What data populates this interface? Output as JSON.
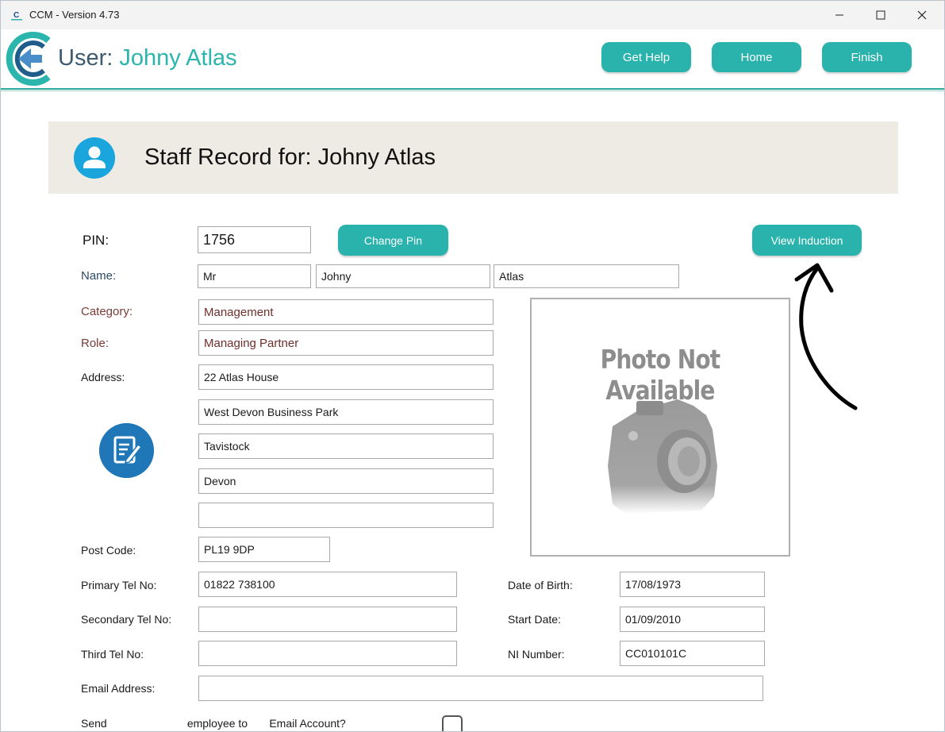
{
  "window": {
    "title": "CCM - Version 4.73",
    "controls": [
      "minimize-icon",
      "maximize-icon",
      "close-icon"
    ]
  },
  "header": {
    "user_prefix": "User: ",
    "user_name": "Johny Atlas",
    "buttons": {
      "help": "Get Help",
      "home": "Home",
      "finish": "Finish"
    }
  },
  "banner": {
    "icon": "user-icon",
    "title": "Staff Record for: Johny Atlas"
  },
  "form": {
    "pin": {
      "label": "PIN:",
      "value": "1756",
      "change_button": "Change Pin"
    },
    "view_induction_button": "View Induction",
    "name": {
      "label": "Name:",
      "title": "Mr",
      "first": "Johny",
      "last": "Atlas"
    },
    "category": {
      "label": "Category:",
      "value": "Management"
    },
    "role": {
      "label": "Role:",
      "value": "Managing Partner"
    },
    "address": {
      "label": "Address:",
      "lines": [
        "22 Atlas House",
        "West Devon Business Park",
        "Tavistock",
        "Devon",
        ""
      ]
    },
    "post_code": {
      "label": "Post Code:",
      "value": "PL19 9DP"
    },
    "primary_tel": {
      "label": "Primary Tel No:",
      "value": "01822 738100"
    },
    "secondary_tel": {
      "label": "Secondary Tel No:",
      "value": ""
    },
    "third_tel": {
      "label": "Third Tel No:",
      "value": ""
    },
    "email": {
      "label": "Email Address:",
      "value": ""
    },
    "dob": {
      "label": "Date of Birth:",
      "value": "17/08/1973"
    },
    "start_date": {
      "label": "Start Date:",
      "value": "01/09/2010"
    },
    "ni_number": {
      "label": "NI Number:",
      "value": "CC010101C"
    },
    "partial_row": "Send                          employee to       Email Account?"
  },
  "photo": {
    "text": "Photo Not Available",
    "icon": "camera-icon"
  },
  "colors": {
    "accent": "#2ab3ad",
    "banner_bg": "#edebe3",
    "user_icon": "#1aa5dc",
    "edit_icon": "#1f77b7"
  }
}
